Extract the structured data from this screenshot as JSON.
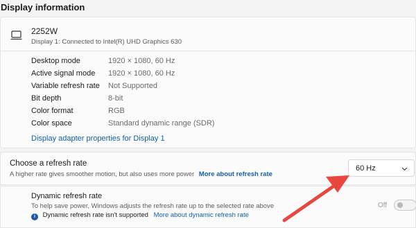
{
  "section": {
    "title": "Display information"
  },
  "display": {
    "name": "2252W",
    "subtitle": "Display 1: Connected to Intel(R) UHD Graphics 630",
    "icon": "monitor-icon",
    "rows": [
      {
        "key": "Desktop mode",
        "value": "1920 × 1080, 60 Hz"
      },
      {
        "key": "Active signal mode",
        "value": "1920 × 1080, 60 Hz"
      },
      {
        "key": "Variable refresh rate",
        "value": "Not Supported"
      },
      {
        "key": "Bit depth",
        "value": "8-bit"
      },
      {
        "key": "Color format",
        "value": "RGB"
      },
      {
        "key": "Color space",
        "value": "Standard dynamic range (SDR)"
      }
    ],
    "adapter_link": "Display adapter properties for Display 1"
  },
  "refresh_rate": {
    "title": "Choose a refresh rate",
    "description": "A higher rate gives smoother motion, but also uses more power",
    "more_link": "More about refresh rate",
    "selected": "60 Hz"
  },
  "dynamic_refresh": {
    "title": "Dynamic refresh rate",
    "description": "To help save power, Windows adjusts the refresh rate up to the selected rate above",
    "note": "Dynamic refresh rate isn't supported",
    "more_link": "More about dynamic refresh rate",
    "toggle_label": "Off",
    "toggle_on": false
  },
  "colors": {
    "link": "#0f5fb0",
    "arrow": "#e8473d",
    "info_icon": "#1e5aa8"
  }
}
